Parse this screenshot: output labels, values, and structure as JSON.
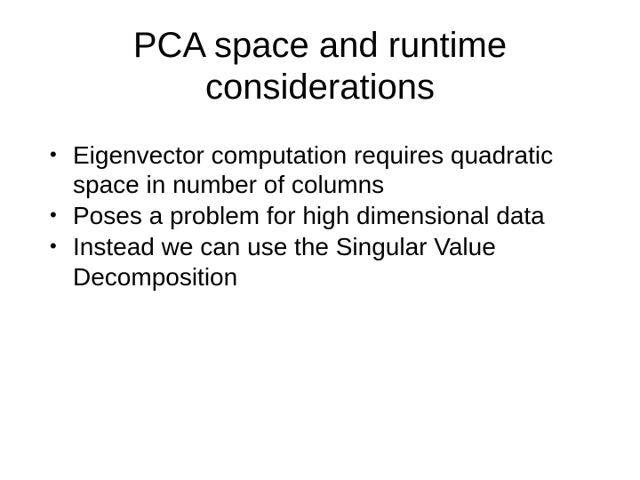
{
  "title": "PCA space and runtime considerations",
  "bullets": [
    "Eigenvector computation requires quadratic space in number of columns",
    "Poses a problem for high dimensional data",
    "Instead we can use the Singular Value Decomposition"
  ]
}
